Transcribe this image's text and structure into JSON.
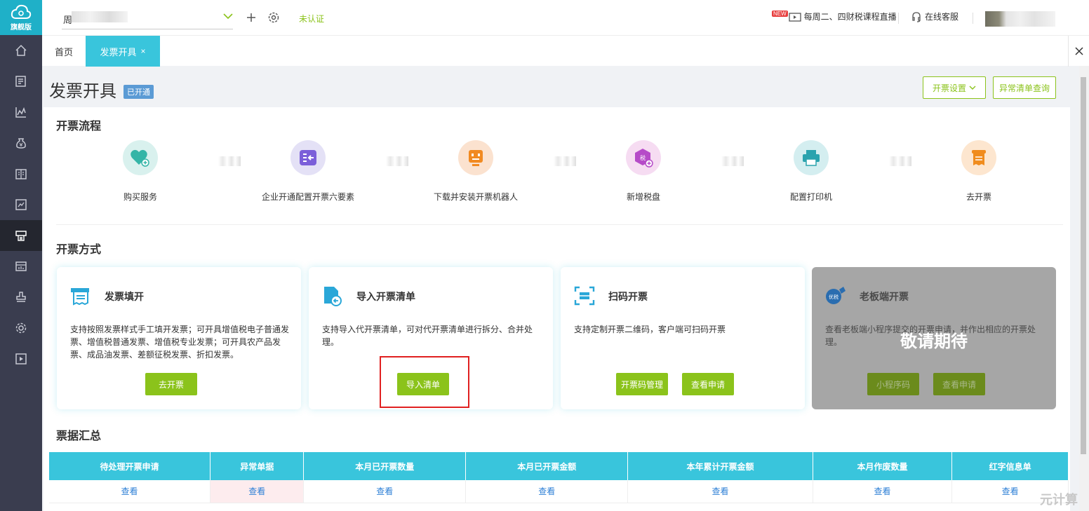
{
  "sidebar": {
    "logo_text": "旗舰版",
    "items": [
      {
        "icon": "home-icon"
      },
      {
        "icon": "invoice-list-icon"
      },
      {
        "icon": "chart-icon"
      },
      {
        "icon": "money-bag-icon"
      },
      {
        "icon": "ledger-icon"
      },
      {
        "icon": "report-icon"
      },
      {
        "icon": "invoice-printer-icon",
        "active": true
      },
      {
        "icon": "dashboard-icon"
      },
      {
        "icon": "stamp-icon"
      },
      {
        "icon": "gear-icon"
      },
      {
        "icon": "video-icon"
      }
    ]
  },
  "topbar": {
    "company_name": "周",
    "unverified": "未认证",
    "live_badge": "NEW",
    "live_text": "每周二、四财税课程直播",
    "service_text": "在线客服"
  },
  "tabs": {
    "home": "首页",
    "active": "发票开具",
    "close": "×"
  },
  "page": {
    "title": "发票开具",
    "status_badge": "已开通",
    "settings_button": "开票设置",
    "abnormal_button": "异常清单查询"
  },
  "process": {
    "title": "开票流程",
    "steps": [
      {
        "label": "购买服务",
        "icon": "heart-plus-icon"
      },
      {
        "label": "企业开通配置开票六要素",
        "icon": "config-arrow-icon"
      },
      {
        "label": "下载并安装开票机器人",
        "icon": "robot-icon"
      },
      {
        "label": "新增税盘",
        "icon": "tax-disk-icon",
        "icon_text": "税"
      },
      {
        "label": "配置打印机",
        "icon": "printer-icon"
      },
      {
        "label": "去开票",
        "icon": "receipt-icon"
      }
    ]
  },
  "methods": {
    "title": "开票方式",
    "cards": [
      {
        "title": "发票填开",
        "desc": "支持按照发票样式手工填开发票；可开具增值税电子普通发票、增值税普通发票、增值税专业发票；可开具农产品发票、成品油发票、差额征税发票、折扣发票。",
        "buttons": [
          "去开票"
        ]
      },
      {
        "title": "导入开票清单",
        "desc": "支持导入代开票清单，可对代开票清单进行拆分、合并处理。",
        "buttons": [
          "导入清单"
        ]
      },
      {
        "title": "扫码开票",
        "desc": "支持定制开票二维码，客户端可扫码开票",
        "buttons": [
          "开票码管理",
          "查看申请"
        ]
      },
      {
        "title": "老板端开票",
        "icon_text": "优税",
        "desc": "查看老板端小程序提交的开票申请，并作出相应的开票处理。",
        "overlay": "敬请期待",
        "buttons": [
          "小程序码",
          "查看申请"
        ]
      }
    ]
  },
  "summary": {
    "title": "票据汇总",
    "columns": [
      "待处理开票申请",
      "异常单据",
      "本月已开票数量",
      "本月已开票金额",
      "本年累计开票金额",
      "本月作废数量",
      "红字信息单"
    ],
    "row": [
      "查看",
      "查看",
      "查看",
      "查看",
      "查看",
      "查看",
      "查看"
    ]
  },
  "watermark": "元计算"
}
